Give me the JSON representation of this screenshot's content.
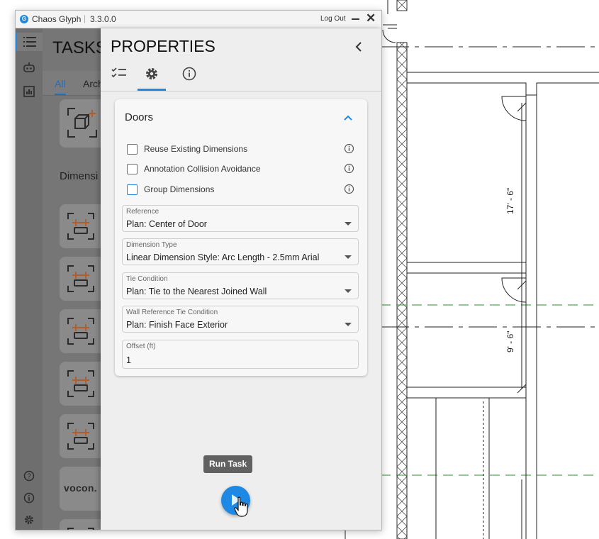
{
  "window": {
    "app_name": "Chaos Glyph",
    "version": "3.3.0.0",
    "logout_label": "Log Out"
  },
  "rail": {
    "icons": [
      "list-icon",
      "robot-icon",
      "chart-icon",
      "help-icon",
      "info-icon",
      "gear-icon"
    ]
  },
  "tasks_panel": {
    "title": "TASKS",
    "tabs": [
      {
        "label": "All"
      },
      {
        "label": "Arch"
      }
    ],
    "group_label": "Dimensi",
    "tile_logo_text": "vocon."
  },
  "properties": {
    "title": "PROPERTIES",
    "tabs": [
      "checklist-icon",
      "gear-icon",
      "info-icon"
    ],
    "section": {
      "title": "Doors",
      "checkboxes": [
        {
          "label": "Reuse Existing Dimensions",
          "checked": false
        },
        {
          "label": "Annotation Collision Avoidance",
          "checked": false
        },
        {
          "label": "Group Dimensions",
          "checked": false
        }
      ],
      "fields": [
        {
          "label": "Reference",
          "value": "Plan: Center of Door"
        },
        {
          "label": "Dimension Type",
          "value": "Linear Dimension Style: Arc Length - 2.5mm Arial"
        },
        {
          "label": "Tie Condition",
          "value": "Plan: Tie to the Nearest Joined Wall"
        },
        {
          "label": "Wall Reference Tie Condition",
          "value": "Plan: Finish Face Exterior"
        }
      ],
      "offset": {
        "label": "Offset (ft)",
        "value": "1"
      }
    }
  },
  "run_task": {
    "tooltip": "Run Task"
  },
  "drawing": {
    "dimension_1": "17' - 6\"",
    "dimension_2": "9' - 6\"",
    "gridline_color": "#2e8b2e"
  },
  "colors": {
    "accent": "#1e88e5"
  }
}
